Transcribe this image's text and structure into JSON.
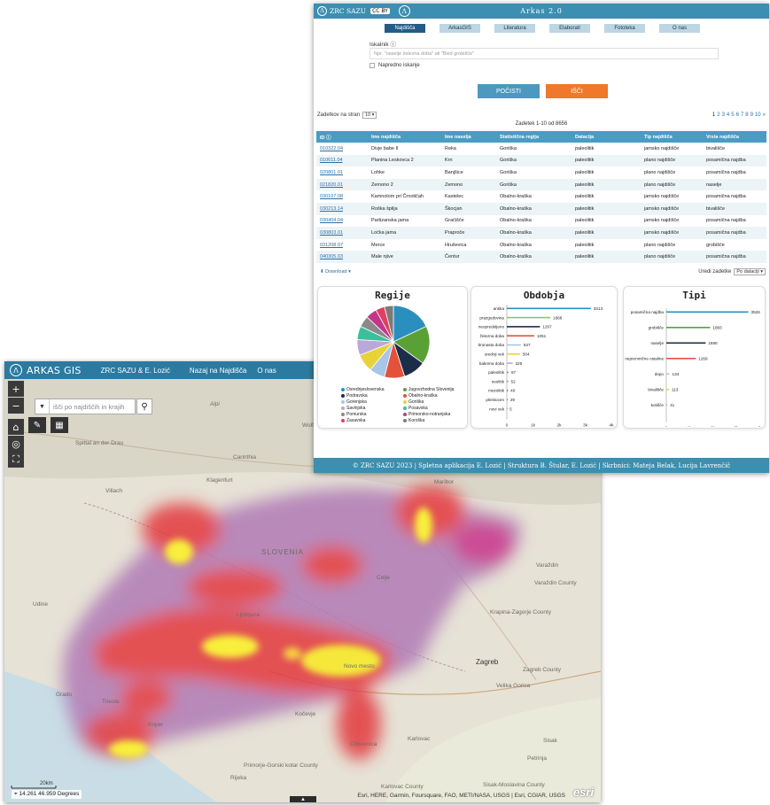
{
  "gis": {
    "app_title": "ARKAS GIS",
    "byline": "ZRC SAZU & E. Lozić",
    "nav": [
      "Nazaj na Najdišča",
      "O nas"
    ],
    "search_placeholder": "išči po najdiščih in krajih",
    "coords": "14.261 46.959 Degrees",
    "scale": "20km",
    "attribution": "Esri, HERE, Garmin, Foursquare, FAO, METI/NASA, USGS | Esri, CGIAR, USGS",
    "esri_logo": "esri",
    "place_labels": [
      "Spittal an der Drau",
      "Villach",
      "Klagenfurt",
      "Carinthia",
      "Wolfsberg",
      "Maribor",
      "SLOVENIA",
      "Varaždin",
      "Varaždin County",
      "Krapina-Zagorje County",
      "Ljubljana",
      "Udine",
      "Novo mesto",
      "Zagreb",
      "Zagreb County",
      "Velika Gorica",
      "Grado",
      "Trieste",
      "Karlovac",
      "Sisak",
      "Primorje-Gorski kotar County",
      "Rijeka",
      "Karlovac County",
      "Petrinja",
      "Sisak-Moslavina County",
      "Alpi",
      "Koper",
      "Celje",
      "Kočevje",
      "Crikvenica"
    ]
  },
  "arkas": {
    "org": "ZRC SAZU",
    "cc_badge": "CC BY",
    "title": "Arkas 2.0",
    "tabs": [
      "Najdišča",
      "ArkasGIS",
      "Literatura",
      "Elaborati",
      "Fototeka",
      "O nas"
    ],
    "search_label": "Iskalnik ⓘ",
    "search_placeholder": "Npr. \"naselje železna doba\" ali \"Bled grobišče\"",
    "advanced": "Napredno iskanje",
    "btn_clear": "POČISTI",
    "btn_search": "IŠČI",
    "per_page_label": "Zadetkov na stran",
    "per_page": "10",
    "records": "Zadetek 1-10 od 8656",
    "pages": [
      "1",
      "2",
      "3",
      "4",
      "5",
      "6",
      "7",
      "8",
      "9",
      "10",
      "»"
    ],
    "table": {
      "headers": [
        "ID ⓘ",
        "Ime najdišča",
        "Ime naselja",
        "Statistična regija",
        "Datacija",
        "Tip najdišča",
        "Vrsta najdišča"
      ],
      "rows": [
        [
          "010322.04",
          "Divje babe II",
          "Reka",
          "Goriška",
          "paleolitik",
          "jamsko najdišče",
          "bivališče"
        ],
        [
          "010611.04",
          "Planina Leskovca 2",
          "Krn",
          "Goriška",
          "paleolitik",
          "plano najdišče",
          "posamična najdba"
        ],
        [
          "020801.01",
          "Lohke",
          "Banjšice",
          "Goriška",
          "paleolitik",
          "plano najdišče",
          "posamična najdba"
        ],
        [
          "021820.01",
          "Zemono 2",
          "Zemono",
          "Goriška",
          "paleolitik",
          "plano najdišče",
          "naselje"
        ],
        [
          "030107.08",
          "Kamnolom pri Črnotičah",
          "Kastelec",
          "Obalno-kraška",
          "paleolitik",
          "jamsko najdišče",
          "posamična najdba"
        ],
        [
          "030213.14",
          "Roška špilja",
          "Škocjan",
          "Obalno-kraška",
          "paleolitik",
          "jamsko najdišče",
          "bivališče"
        ],
        [
          "030404.04",
          "Partizanska jama",
          "Gračišče",
          "Obalno-kraška",
          "paleolitik",
          "jamsko najdišče",
          "posamična najdba"
        ],
        [
          "030803.01",
          "Ločka jama",
          "Praproče",
          "Obalno-kraška",
          "paleolitik",
          "jamsko najdišče",
          "posamična najdba"
        ],
        [
          "031208.07",
          "Merce",
          "Hruševica",
          "Obalno-kraška",
          "paleolitik",
          "plano najdišče",
          "grobišče"
        ],
        [
          "040305.03",
          "Male njive",
          "Čentur",
          "Obalno-kraška",
          "paleolitik",
          "plano najdišče",
          "posamična najdba"
        ]
      ]
    },
    "download": "Download",
    "sort_label": "Uredi zadetke",
    "sort_value": "Po dataciji",
    "footer": "© ZRC SAZU 2023 | Spletna aplikacija E. Lozić | Struktura B. Štular, E. Lozić | Skrbnici: Mateja Belak, Lucija Lavrenčič"
  },
  "chart_data": [
    {
      "type": "pie",
      "title": "Regije",
      "categories": [
        "Osrednjeslovenska",
        "Jugovzhodna Slovenija",
        "Podravska",
        "Obalno-kraška",
        "Gorenjska",
        "Goriška",
        "Savinjska",
        "Posavska",
        "Pomurska",
        "Primorsko-notranjska",
        "Zasavska",
        "Koroška"
      ],
      "values": [
        18,
        17,
        10,
        9,
        7,
        8,
        7,
        6,
        5,
        5,
        4,
        4
      ],
      "colors": [
        "#2a8fbf",
        "#5aa135",
        "#1c2d4a",
        "#e3533b",
        "#a8c6e6",
        "#e8d23a",
        "#b9a8d9",
        "#3cbf9b",
        "#8a8a8a",
        "#c2368a",
        "#e04060",
        "#7a7a7a"
      ]
    },
    {
      "type": "bar",
      "orientation": "horizontal",
      "title": "Obdobja",
      "categories": [
        "antika",
        "prazgodovina",
        "neopredeljeno",
        "železna doba",
        "bronasta doba",
        "srednji vek",
        "bakrena doba",
        "paleolitik",
        "neolitik",
        "mezolitik",
        "pleistocen",
        "novi vek"
      ],
      "values": [
        3213,
        1666,
        1267,
        1051,
        537,
        504,
        225,
        67,
        52,
        40,
        29,
        5
      ],
      "colors": [
        "#2a8fbf",
        "#8fc46a",
        "#1c2d4a",
        "#e3533b",
        "#a8c6e6",
        "#e8d23a",
        "#b9a8d9",
        "#3cbf9b",
        "#8a8a8a",
        "#c2368a",
        "#e04060",
        "#7a7a7a"
      ],
      "xlim": [
        0,
        4000
      ],
      "ticks": [
        "0",
        "1k",
        "2k",
        "3k",
        "4k"
      ]
    },
    {
      "type": "bar",
      "orientation": "horizontal",
      "title": "Tipi",
      "categories": [
        "posamična najdba",
        "grobišče",
        "naselje",
        "neprenmične ostaline",
        "depo",
        "bivališče",
        "kotišče"
      ],
      "values": [
        3526,
        1883,
        1690,
        1269,
        134,
        113,
        41
      ],
      "colors": [
        "#2a8fbf",
        "#5aa135",
        "#1c2d4a",
        "#e3533b",
        "#a8c6e6",
        "#e8d23a",
        "#b9a8d9"
      ],
      "xlim": [
        0,
        4000
      ],
      "ticks": [
        "0",
        "1k",
        "2k",
        "3k",
        "4k"
      ]
    }
  ]
}
